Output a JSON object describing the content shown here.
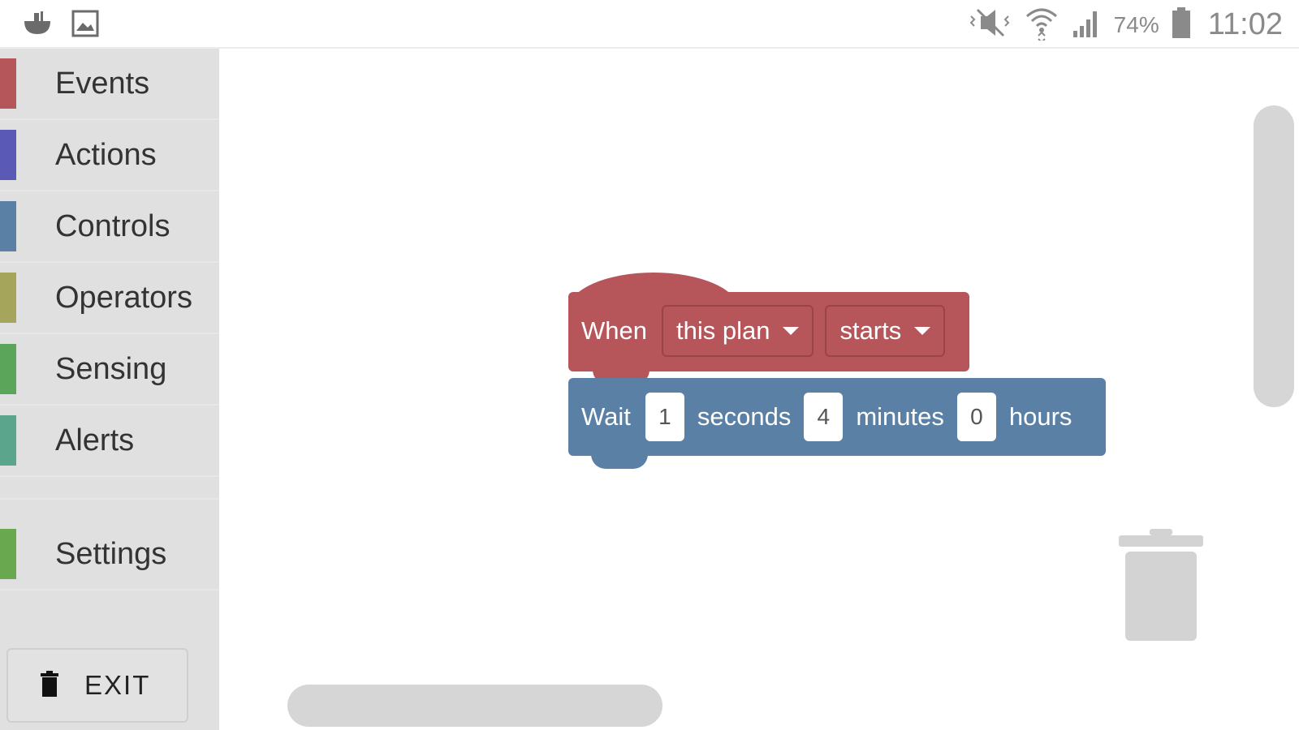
{
  "status_bar": {
    "battery_percent": "74%",
    "time": "11:02",
    "left_icons": [
      "notification-app-icon",
      "image-icon"
    ],
    "right_icons": [
      "mute-vibrate-icon",
      "wifi-icon",
      "signal-icon",
      "battery-icon"
    ]
  },
  "sidebar": {
    "categories": [
      {
        "label": "Events",
        "color": "#b5565b"
      },
      {
        "label": "Actions",
        "color": "#5b59b6"
      },
      {
        "label": "Controls",
        "color": "#5b80a5"
      },
      {
        "label": "Operators",
        "color": "#a5a55b"
      },
      {
        "label": "Sensing",
        "color": "#5ba55b"
      },
      {
        "label": "Alerts",
        "color": "#5ba58c"
      },
      {
        "label": "Settings",
        "color": "#6aa84f"
      }
    ],
    "exit_label": "EXIT"
  },
  "workspace": {
    "when_block": {
      "label": "When",
      "dropdown1": "this plan",
      "dropdown2": "starts",
      "color": "#b6565b"
    },
    "wait_block": {
      "label": "Wait",
      "seconds_value": "1",
      "seconds_label": "seconds",
      "minutes_value": "4",
      "minutes_label": "minutes",
      "hours_value": "0",
      "hours_label": "hours",
      "color": "#5b80a5"
    }
  }
}
